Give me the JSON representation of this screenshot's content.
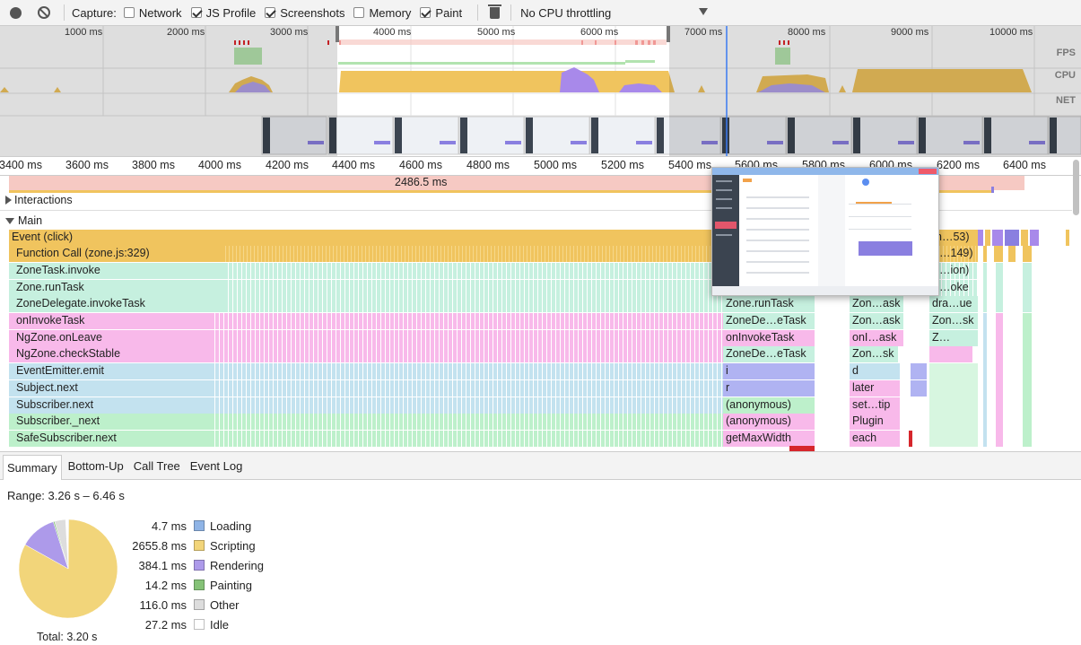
{
  "toolbar": {
    "capture_label": "Capture:",
    "checkboxes": [
      {
        "label": "Network",
        "checked": false
      },
      {
        "label": "JS Profile",
        "checked": true
      },
      {
        "label": "Screenshots",
        "checked": true
      },
      {
        "label": "Memory",
        "checked": false
      },
      {
        "label": "Paint",
        "checked": true
      }
    ],
    "throttling": "No CPU throttling"
  },
  "overview": {
    "ticks": [
      "1000 ms",
      "2000 ms",
      "3000 ms",
      "4000 ms",
      "5000 ms",
      "6000 ms",
      "7000 ms",
      "8000 ms",
      "9000 ms",
      "10000 ms"
    ],
    "track_labels": [
      "FPS",
      "CPU",
      "NET"
    ]
  },
  "ruler": {
    "ticks": [
      "3400 ms",
      "3600 ms",
      "3800 ms",
      "4000 ms",
      "4200 ms",
      "4400 ms",
      "4600 ms",
      "4800 ms",
      "5000 ms",
      "5200 ms",
      "5400 ms",
      "5600 ms",
      "5800 ms",
      "6000 ms",
      "6200 ms",
      "6400 ms"
    ]
  },
  "interactions": {
    "label": "Interactions",
    "duration": "2486.5 ms"
  },
  "main": {
    "label": "Main",
    "rows": [
      {
        "name": "Event (click)",
        "color": "#f0c45e",
        "cells": [
          "n…53)"
        ]
      },
      {
        "name": "Function Call (zone.js:329)",
        "color": "#f0c45e",
        "cells": [
          "…149)"
        ]
      },
      {
        "name": "ZoneTask.invoke",
        "color": "#c6f0df",
        "cells": [
          "…ion)"
        ]
      },
      {
        "name": "Zone.runTask",
        "color": "#c6f0df",
        "cells": [
          "…oke"
        ]
      },
      {
        "name": "ZoneDelegate.invokeTask",
        "color": "#c6f0df",
        "cells": [
          "Zone.runTask",
          "Zon…ask",
          "dra…ue"
        ]
      },
      {
        "name": "onInvokeTask",
        "color": "#f8b9ea",
        "cells": [
          "ZoneDe…eTask",
          "Zon…ask",
          "Zon…sk"
        ]
      },
      {
        "name": "NgZone.onLeave",
        "color": "#f8b9ea",
        "cells": [
          "onInvokeTask",
          "onI…ask",
          "Z…"
        ]
      },
      {
        "name": "NgZone.checkStable",
        "color": "#f8b9ea",
        "cells": [
          "ZoneDe…eTask",
          "Zon…sk"
        ]
      },
      {
        "name": "EventEmitter.emit",
        "color": "#c3e2ef",
        "cells": [
          "i",
          "d"
        ]
      },
      {
        "name": "Subject.next",
        "color": "#c3e2ef",
        "cells": [
          "r",
          "later"
        ]
      },
      {
        "name": "Subscriber.next",
        "color": "#c3e2ef",
        "cells": [
          "(anonymous)",
          "set…tip"
        ]
      },
      {
        "name": "Subscriber._next",
        "color": "#bdf0cb",
        "cells": [
          "(anonymous)",
          "Plugin"
        ]
      },
      {
        "name": "SafeSubscriber.next",
        "color": "#bdf0cb",
        "cells": [
          "getMaxWidth",
          "each"
        ]
      }
    ]
  },
  "bottom": {
    "tabs": [
      "Summary",
      "Bottom-Up",
      "Call Tree",
      "Event Log"
    ],
    "range": "Range: 3.26 s – 6.46 s",
    "total": "Total: 3.20 s",
    "legend": [
      {
        "value": "4.7 ms",
        "name": "Loading",
        "color": "#8fb4e6"
      },
      {
        "value": "2655.8 ms",
        "name": "Scripting",
        "color": "#f2d57a"
      },
      {
        "value": "384.1 ms",
        "name": "Rendering",
        "color": "#ad9aea"
      },
      {
        "value": "14.2 ms",
        "name": "Painting",
        "color": "#85c277"
      },
      {
        "value": "116.0 ms",
        "name": "Other",
        "color": "#dddddd"
      },
      {
        "value": "27.2 ms",
        "name": "Idle",
        "color": "#ffffff"
      }
    ]
  }
}
